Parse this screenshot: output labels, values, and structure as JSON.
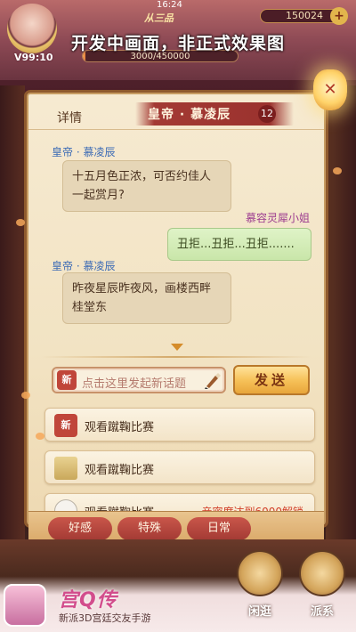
{
  "status_bar": {
    "time": "16:24"
  },
  "hud": {
    "vip": "V99:10",
    "rank": "从三品",
    "currency": "150024",
    "experience": "3000/450000",
    "experience_progress": 0.0067
  },
  "banner": "开发中画面，非正式效果图",
  "dialog": {
    "details_label": "详情",
    "title": "皇帝 · 慕凌辰",
    "title_badge": "12",
    "messages": [
      {
        "side": "left",
        "name": "皇帝 · 慕凌辰",
        "text_lines": [
          "十五月色正浓，可否约佳人",
          "一起赏月?"
        ]
      },
      {
        "side": "right",
        "name": "慕容灵犀小姐",
        "text_lines": [
          "丑拒...丑拒...丑拒......."
        ]
      },
      {
        "side": "left",
        "name": "皇帝 · 慕凌辰",
        "text_lines": [
          "昨夜星辰昨夜风，画楼西畔",
          "桂堂东"
        ]
      }
    ],
    "composer": {
      "new_tag": "新",
      "placeholder": "点击这里发起新话题",
      "send_label": "发送"
    },
    "options": [
      {
        "icon": "new-badge-icon",
        "icon_text": "新",
        "label": "观看蹴鞠比赛",
        "locked_note": ""
      },
      {
        "icon": "scroll-icon",
        "icon_text": "",
        "label": "观看蹴鞠比赛",
        "locked_note": ""
      },
      {
        "icon": "sheep-icon",
        "icon_text": "",
        "label": "观看蹴鞠比赛",
        "locked_note": "亲密度达到6000解锁"
      }
    ],
    "tabs": [
      "好感",
      "特殊",
      "日常"
    ]
  },
  "bottom_nav": {
    "items": [
      "闲逛",
      "派系"
    ]
  },
  "app_banner": {
    "logo": "宫Q传",
    "slogan": "新派3D宫廷交友手游"
  },
  "colors": {
    "title_ribbon": "#a33a34",
    "left_name": "#3c6bb5",
    "right_name": "#9c3c8f",
    "send_button": "#f6c25a",
    "unlock_text": "#d2402a"
  }
}
